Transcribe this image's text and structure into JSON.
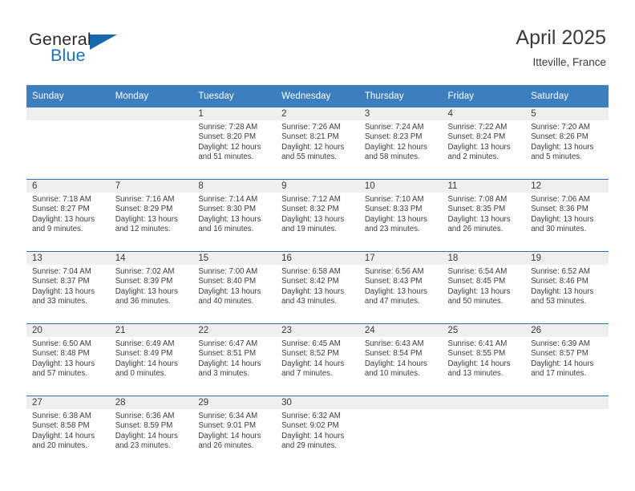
{
  "brand": {
    "name_top": "General",
    "name_bottom": "Blue",
    "triangle_icon": "triangle-icon",
    "color_primary": "#1c71b9",
    "color_text": "#2b2b2b"
  },
  "header": {
    "title": "April 2025",
    "subtitle": "Itteville, France"
  },
  "theme": {
    "header_bg": "#3d7ebf",
    "week_rule": "#2f6fb0",
    "daynum_bg": "#efefef",
    "text": "#3b3b3b"
  },
  "labels": {
    "sunrise": "Sunrise:",
    "sunset": "Sunset:",
    "daylight": "Daylight:"
  },
  "weekday_headers": [
    "Sunday",
    "Monday",
    "Tuesday",
    "Wednesday",
    "Thursday",
    "Friday",
    "Saturday"
  ],
  "weeks": [
    [
      {
        "day": "",
        "sunrise": "",
        "sunset": "",
        "daylight": ""
      },
      {
        "day": "",
        "sunrise": "",
        "sunset": "",
        "daylight": ""
      },
      {
        "day": "1",
        "sunrise": "Sunrise: 7:28 AM",
        "sunset": "Sunset: 8:20 PM",
        "daylight": "Daylight: 12 hours and 51 minutes."
      },
      {
        "day": "2",
        "sunrise": "Sunrise: 7:26 AM",
        "sunset": "Sunset: 8:21 PM",
        "daylight": "Daylight: 12 hours and 55 minutes."
      },
      {
        "day": "3",
        "sunrise": "Sunrise: 7:24 AM",
        "sunset": "Sunset: 8:23 PM",
        "daylight": "Daylight: 12 hours and 58 minutes."
      },
      {
        "day": "4",
        "sunrise": "Sunrise: 7:22 AM",
        "sunset": "Sunset: 8:24 PM",
        "daylight": "Daylight: 13 hours and 2 minutes."
      },
      {
        "day": "5",
        "sunrise": "Sunrise: 7:20 AM",
        "sunset": "Sunset: 8:26 PM",
        "daylight": "Daylight: 13 hours and 5 minutes."
      }
    ],
    [
      {
        "day": "6",
        "sunrise": "Sunrise: 7:18 AM",
        "sunset": "Sunset: 8:27 PM",
        "daylight": "Daylight: 13 hours and 9 minutes."
      },
      {
        "day": "7",
        "sunrise": "Sunrise: 7:16 AM",
        "sunset": "Sunset: 8:29 PM",
        "daylight": "Daylight: 13 hours and 12 minutes."
      },
      {
        "day": "8",
        "sunrise": "Sunrise: 7:14 AM",
        "sunset": "Sunset: 8:30 PM",
        "daylight": "Daylight: 13 hours and 16 minutes."
      },
      {
        "day": "9",
        "sunrise": "Sunrise: 7:12 AM",
        "sunset": "Sunset: 8:32 PM",
        "daylight": "Daylight: 13 hours and 19 minutes."
      },
      {
        "day": "10",
        "sunrise": "Sunrise: 7:10 AM",
        "sunset": "Sunset: 8:33 PM",
        "daylight": "Daylight: 13 hours and 23 minutes."
      },
      {
        "day": "11",
        "sunrise": "Sunrise: 7:08 AM",
        "sunset": "Sunset: 8:35 PM",
        "daylight": "Daylight: 13 hours and 26 minutes."
      },
      {
        "day": "12",
        "sunrise": "Sunrise: 7:06 AM",
        "sunset": "Sunset: 8:36 PM",
        "daylight": "Daylight: 13 hours and 30 minutes."
      }
    ],
    [
      {
        "day": "13",
        "sunrise": "Sunrise: 7:04 AM",
        "sunset": "Sunset: 8:37 PM",
        "daylight": "Daylight: 13 hours and 33 minutes."
      },
      {
        "day": "14",
        "sunrise": "Sunrise: 7:02 AM",
        "sunset": "Sunset: 8:39 PM",
        "daylight": "Daylight: 13 hours and 36 minutes."
      },
      {
        "day": "15",
        "sunrise": "Sunrise: 7:00 AM",
        "sunset": "Sunset: 8:40 PM",
        "daylight": "Daylight: 13 hours and 40 minutes."
      },
      {
        "day": "16",
        "sunrise": "Sunrise: 6:58 AM",
        "sunset": "Sunset: 8:42 PM",
        "daylight": "Daylight: 13 hours and 43 minutes."
      },
      {
        "day": "17",
        "sunrise": "Sunrise: 6:56 AM",
        "sunset": "Sunset: 8:43 PM",
        "daylight": "Daylight: 13 hours and 47 minutes."
      },
      {
        "day": "18",
        "sunrise": "Sunrise: 6:54 AM",
        "sunset": "Sunset: 8:45 PM",
        "daylight": "Daylight: 13 hours and 50 minutes."
      },
      {
        "day": "19",
        "sunrise": "Sunrise: 6:52 AM",
        "sunset": "Sunset: 8:46 PM",
        "daylight": "Daylight: 13 hours and 53 minutes."
      }
    ],
    [
      {
        "day": "20",
        "sunrise": "Sunrise: 6:50 AM",
        "sunset": "Sunset: 8:48 PM",
        "daylight": "Daylight: 13 hours and 57 minutes."
      },
      {
        "day": "21",
        "sunrise": "Sunrise: 6:49 AM",
        "sunset": "Sunset: 8:49 PM",
        "daylight": "Daylight: 14 hours and 0 minutes."
      },
      {
        "day": "22",
        "sunrise": "Sunrise: 6:47 AM",
        "sunset": "Sunset: 8:51 PM",
        "daylight": "Daylight: 14 hours and 3 minutes."
      },
      {
        "day": "23",
        "sunrise": "Sunrise: 6:45 AM",
        "sunset": "Sunset: 8:52 PM",
        "daylight": "Daylight: 14 hours and 7 minutes."
      },
      {
        "day": "24",
        "sunrise": "Sunrise: 6:43 AM",
        "sunset": "Sunset: 8:54 PM",
        "daylight": "Daylight: 14 hours and 10 minutes."
      },
      {
        "day": "25",
        "sunrise": "Sunrise: 6:41 AM",
        "sunset": "Sunset: 8:55 PM",
        "daylight": "Daylight: 14 hours and 13 minutes."
      },
      {
        "day": "26",
        "sunrise": "Sunrise: 6:39 AM",
        "sunset": "Sunset: 8:57 PM",
        "daylight": "Daylight: 14 hours and 17 minutes."
      }
    ],
    [
      {
        "day": "27",
        "sunrise": "Sunrise: 6:38 AM",
        "sunset": "Sunset: 8:58 PM",
        "daylight": "Daylight: 14 hours and 20 minutes."
      },
      {
        "day": "28",
        "sunrise": "Sunrise: 6:36 AM",
        "sunset": "Sunset: 8:59 PM",
        "daylight": "Daylight: 14 hours and 23 minutes."
      },
      {
        "day": "29",
        "sunrise": "Sunrise: 6:34 AM",
        "sunset": "Sunset: 9:01 PM",
        "daylight": "Daylight: 14 hours and 26 minutes."
      },
      {
        "day": "30",
        "sunrise": "Sunrise: 6:32 AM",
        "sunset": "Sunset: 9:02 PM",
        "daylight": "Daylight: 14 hours and 29 minutes."
      },
      {
        "day": "",
        "sunrise": "",
        "sunset": "",
        "daylight": ""
      },
      {
        "day": "",
        "sunrise": "",
        "sunset": "",
        "daylight": ""
      },
      {
        "day": "",
        "sunrise": "",
        "sunset": "",
        "daylight": ""
      }
    ]
  ]
}
